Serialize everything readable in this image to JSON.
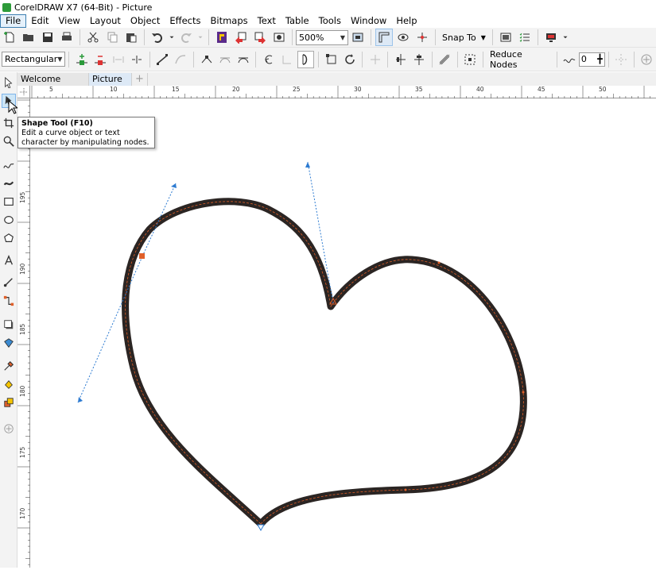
{
  "window": {
    "title": "CorelDRAW X7 (64-Bit) - Picture"
  },
  "menu": [
    {
      "label": "File",
      "active": true
    },
    {
      "label": "Edit"
    },
    {
      "label": "View"
    },
    {
      "label": "Layout"
    },
    {
      "label": "Object"
    },
    {
      "label": "Effects"
    },
    {
      "label": "Bitmaps"
    },
    {
      "label": "Text"
    },
    {
      "label": "Table"
    },
    {
      "label": "Tools"
    },
    {
      "label": "Window"
    },
    {
      "label": "Help"
    }
  ],
  "toolbar": {
    "zoom_value": "500%",
    "snap_to_label": "Snap To"
  },
  "property_bar": {
    "selection_mode": "Rectangular",
    "reduce_nodes_label": "Reduce Nodes",
    "curve_smoothness_value": "0"
  },
  "tabs": [
    {
      "label": "Welcome Screen"
    },
    {
      "label": "Picture",
      "active": true
    }
  ],
  "ruler": {
    "horizontal_labels": [
      "5",
      "10",
      "15",
      "20",
      "25",
      "30",
      "35",
      "40",
      "45",
      "50"
    ],
    "vertical_labels": [
      "195",
      "190",
      "185",
      "180",
      "175",
      "170"
    ]
  },
  "tooltip": {
    "title": "Shape Tool (F10)",
    "body": "Edit a curve object or text character by manipulating nodes."
  },
  "colors": {
    "toolbar_bg": "#f3f3f3",
    "curve_stroke": "#2b2523",
    "node_color": "#e0602a",
    "handle_color": "#2d7bd1",
    "active_tab": "#dde9f6"
  }
}
